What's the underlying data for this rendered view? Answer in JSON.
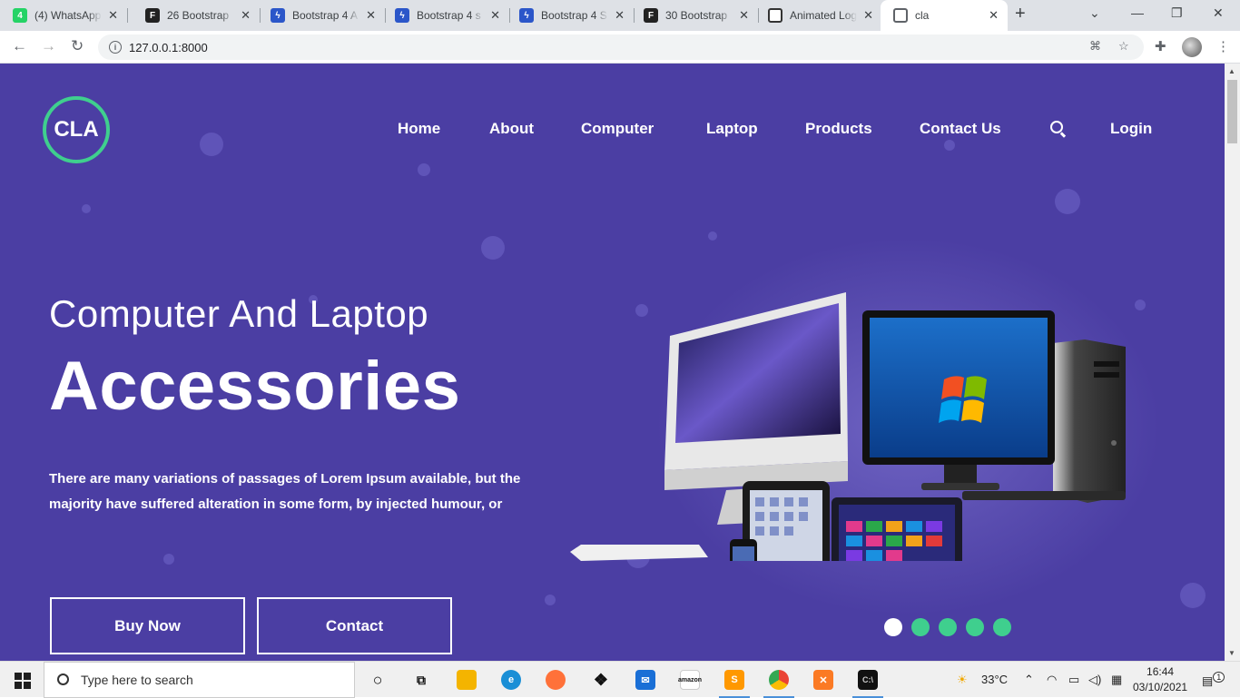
{
  "browser": {
    "tabs": [
      {
        "title": "(4) WhatsApp",
        "icon": "whatsapp-icon",
        "badge": "4"
      },
      {
        "title": "26 Bootstrap",
        "icon": "f-logo-icon"
      },
      {
        "title": "Bootstrap 4 A",
        "icon": "s-logo-icon"
      },
      {
        "title": "Bootstrap 4 s",
        "icon": "s-logo-icon"
      },
      {
        "title": "Bootstrap 4 S",
        "icon": "s-logo-icon"
      },
      {
        "title": "30 Bootstrap",
        "icon": "f-logo-icon"
      },
      {
        "title": "Animated Log",
        "icon": "codepen-icon"
      },
      {
        "title": "cla",
        "icon": "globe-icon",
        "active": true
      }
    ],
    "url": "127.0.0.1:8000"
  },
  "site": {
    "logo": "CLA",
    "nav": [
      "Home",
      "About",
      "Computer",
      "Laptop",
      "Products",
      "Contact Us"
    ],
    "login": "Login",
    "hero": {
      "subtitle": "Computer And Laptop",
      "title": "Accessories",
      "description": "There are many variations of passages of Lorem Ipsum available, but the majority have suffered alteration in some form, by injected humour, or",
      "buttons": [
        "Buy Now",
        "Contact"
      ]
    },
    "carousel": {
      "count": 5,
      "active": 0
    },
    "colors": {
      "background": "#4b3ea3",
      "accent": "#3fcf8e"
    }
  },
  "taskbar": {
    "search_placeholder": "Type here to search",
    "weather": "33°C",
    "time": "16:44",
    "date": "03/10/2021",
    "notification_count": "1"
  }
}
